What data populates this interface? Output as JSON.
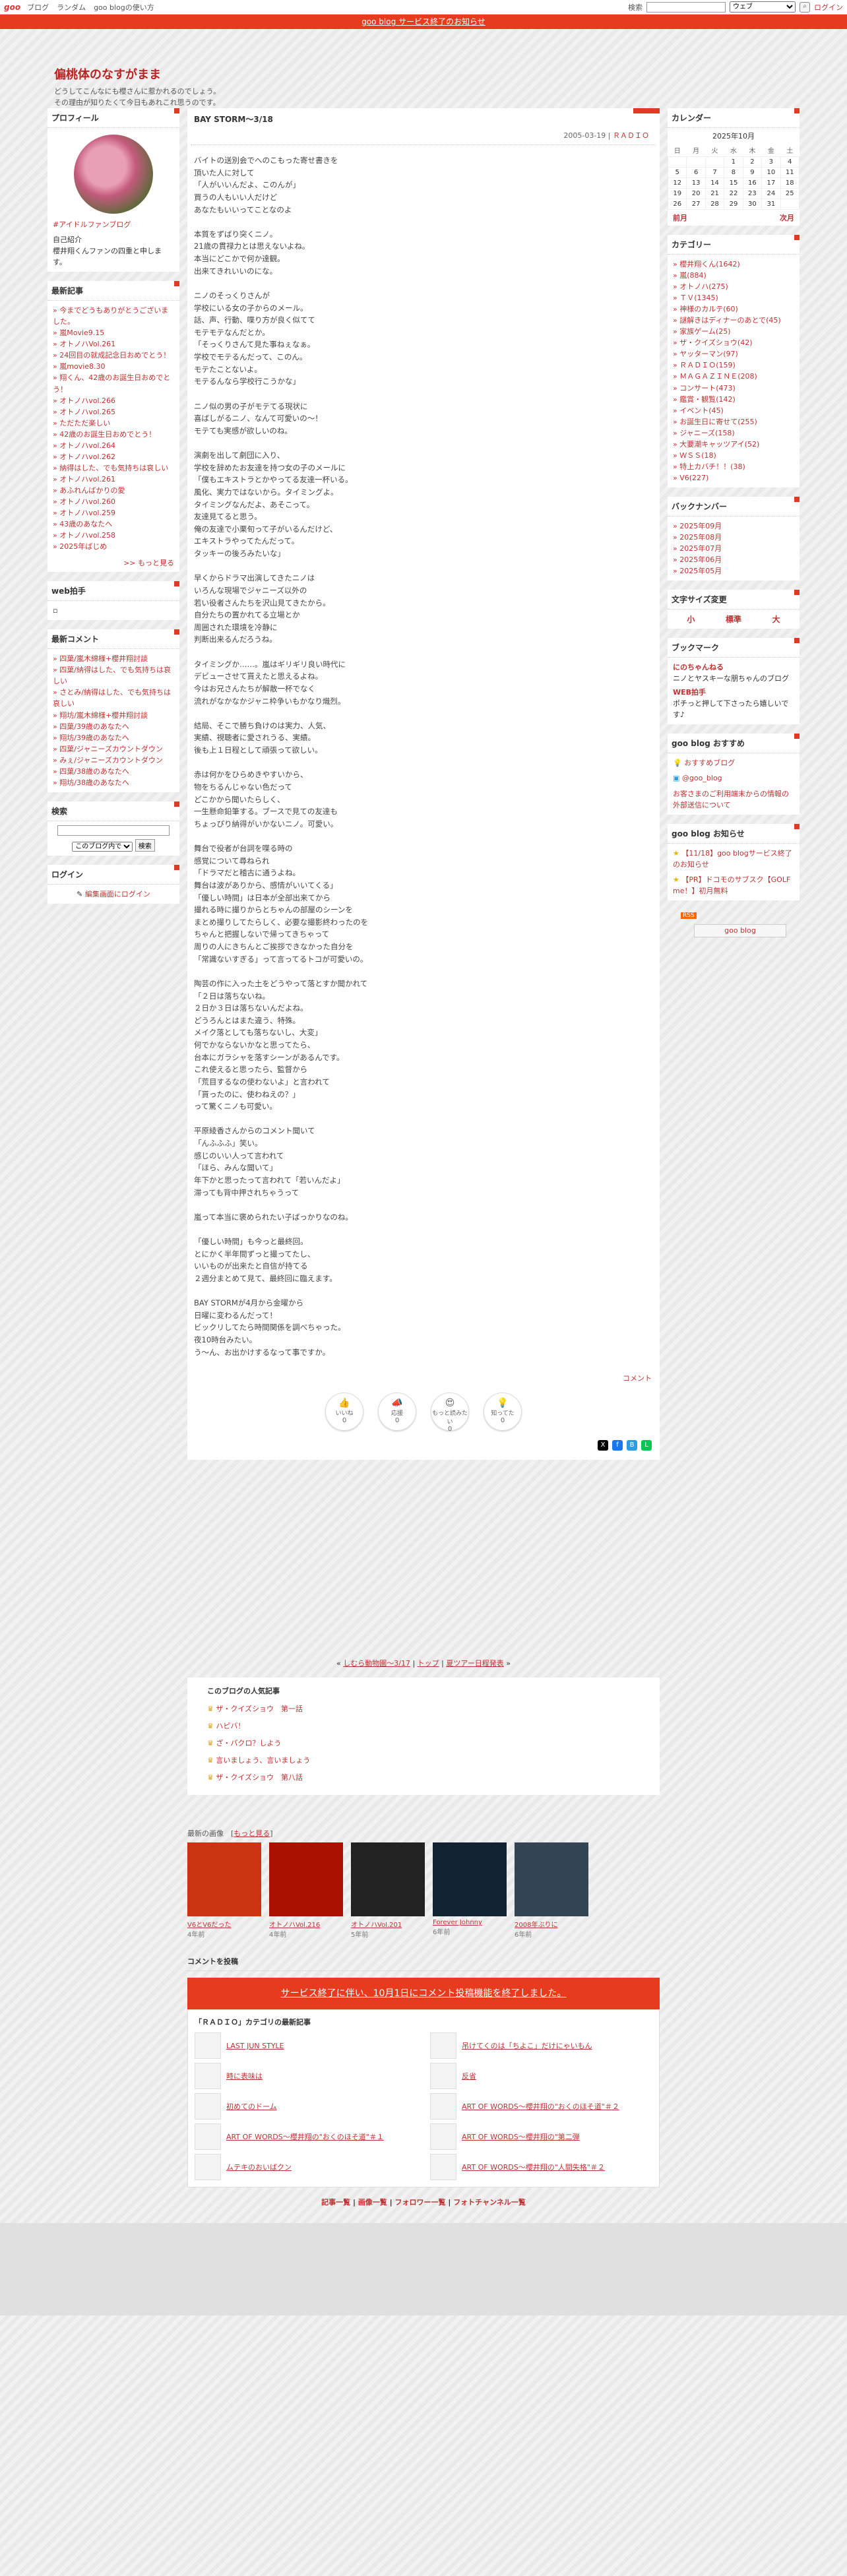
{
  "topbar": {
    "logo": "goo",
    "links": [
      "ブログ",
      "ランダム",
      "goo blogの使い方"
    ],
    "search_label": "検索",
    "search_scope": "ウェブ",
    "login": "ログイン"
  },
  "notice": "goo blog サービス終了のお知らせ",
  "blog": {
    "title": "偏桃体のなすがまま",
    "desc1": "どうしてこんなにも櫻さんに惹かれるのでしょう。",
    "desc2": "その理由が知りたくて今日もあれこれ思うのです。"
  },
  "profile": {
    "heading": "プロフィール",
    "link": "#アイドルファンブログ",
    "intro_title": "自己紹介",
    "intro": "櫻井翔くんファンの四重と申します。"
  },
  "recent": {
    "heading": "最新記事",
    "items": [
      "今までどうもありがとうございました。",
      "嵐Movie9.15",
      "オトノハVol.261",
      "24回目の就成記念日おめでとう！",
      "嵐movie8.30",
      "翔くん、42歳のお誕生日おめでとう！",
      "オトノハvol.266",
      "オトノハvol.265",
      "ただただ楽しい",
      "42歳のお誕生日おめでとう！",
      "オトノハvol.264",
      "オトノハvol.262",
      "納得はした、でも気持ちは哀しい",
      "オトノハvol.261",
      "あふれんばかりの愛",
      "オトノハvol.260",
      "オトノハvol.259",
      "43歳のあなたへ",
      "オトノハvol.258",
      "2025年ばじめ"
    ],
    "more": ">> もっと見る"
  },
  "webclap": {
    "heading": "web拍手"
  },
  "comments": {
    "heading": "最新コメント",
    "items": [
      "四葉/嵐木綿様+櫻井翔討談",
      "四葉/納得はした、でも気持ちは哀しい",
      "さとみ/納得はした、でも気持ちは哀しい",
      "翔坊/嵐木綿様+櫻井翔討談",
      "四葉/39歳のあなたへ",
      "翔坊/39歳のあなたへ",
      "四葉/ジャニーズカウントダウン",
      "みぇ/ジャニーズカウントダウン",
      "四葉/38歳のあなたへ",
      "翔坊/38歳のあなたへ"
    ]
  },
  "search": {
    "heading": "検索",
    "scope": "このブログ内で",
    "button": "検索"
  },
  "login": {
    "heading": "ログイン",
    "link": "編集画面にログイン"
  },
  "entry": {
    "title": "BAY STORM〜3/18",
    "date": "2005-03-19",
    "category": "ＲＡＤＩＯ",
    "comment_label": "コメント",
    "text": "バイトの送別会でへのこもった寄せ書きを\n頂いた人に対して\n「人がいいんだよ、このんが」\n買うの人もいい人だけど\nあなたもいいってことなのよ\n\n本質をずばり突くニノ。\n21歳の貫禄力とは思えないよね。\n本当にどこかで何か達観。\n出来てきれいいのにな。\n\nニノのそっくりさんが\n学校にいる女の子からのメール。\n話、声、行動、喋り方が良く似てて\nモテモテなんだとか。\n「そっくりさんて見た事ねぇなぁ。\n学校でモテるんだって、このん。\nモテたことないよ。\nモテるんなら学校行こうかな」\n\nニノ似の男の子がモテてる現状に\n喜ばしがるニノ、なんて可愛いの〜！\nモテても実感が欲しいのね。\n\n演劇を出して劇団に入り、\n学校を辞めたお友達を持つ女の子のメールに\n「僕もエキストラとかやってる友達一杯いる。\n風化、実力ではないから。タイミングよ。\nタイミングなんだよ、あそこって。\n友達見てると思う。\n俺の友達で小栗旬って子がいるんだけど、\nエキストラやってたんだって。\nタッキーの後ろみたいな」\n\n早くからドラマ出演してきたニノは\nいろんな現場でジャニーズ以外の\n若い役者さんたちを沢山見てきたから。\n自分たちの置かれてる立場とか\n周囲された環境を冷静に\n判断出来るんだろうね。\n\nタイミングか……。嵐はギリギリ良い時代に\nデビューさせて貰えたと思えるよね。\n今はお兄さんたちが解散一杯でなく\n流れがなかなかジャニ枠争いもかなり熾烈。\n\n結局、そこで勝ち負けのは実力、人気、\n実績、視聴者に愛されうる、実績。\n後も上１日程として頑張って欲しい。\n\n赤は何かをひらめきやすいから、\n物をちるんじゃない色だって\nどこかから聞いたらしく、\n一生懸命鉛筆する。ブースで見ての友達も\nちょっぴり納得がいかないニノ。可愛い。\n\n舞台で役者が台詞を喋る時の\n感覚について尋ねられ\n「ドラマだと稽古に通うよね。\n舞台は波がありから、感情がいいてくる」\n「優しい時間」は日本が全部出来てから\n撮れる時に撮りからとちゃんの部屋のシーンを\nまとめ撮りしてたらしく、必要な撮影終わったのを\nちゃんと把握しないで帰ってきちゃって\n周りの人にきちんとご挨拶できなかった自分を\n「常識ないすぎる」って言ってるトコが可愛いの。\n\n陶芸の作に入った土をどうやって落とすか聞かれて\n「２日は落ちないね。\n２日か３日は落ちないんだよね。\nどうろんとはまた違う、特殊。\nメイク落としても落ちないし、大変」\n何でかならないかなと思ってたら、\n台本にガラシャを落すシーンがあるんです。\nこれ使えると思ったら、監督から\n「荒目するなの使わないよ」と言われて\n「貰ったのに、使わねえの？」\nって驚くニノも可愛い。\n\n平原綾香さんからのコメント聞いて\n「んふふふ」笑い。\n感じのいい人って言われて\n「ほら、みんな聞いて」\n年下かと思ったって言われて「若いんだよ」\n滞っても背中押されちゃうって\n\n嵐って本当に褒められたい子ばっかりなのね。\n\n「優しい時間」も今っと最終回。\nとにかく半年間ずっと撮ってたし、\nいいものが出来たと自信が持てる\n２週分まとめて見て、最終回に臨えます。\n\nBAY STORMが4月から金曜から\n日曜に変わるんだって！\nビックリしてたら時間関係を調べちゃった。\n夜10時台みたい。\nう〜ん、お出かけするなって事ですか。"
  },
  "reactions": [
    {
      "label": "いいね",
      "count": "0"
    },
    {
      "label": "応援",
      "count": "0"
    },
    {
      "label": "もっと読みたい",
      "count": "0"
    },
    {
      "label": "知ってた",
      "count": "0"
    }
  ],
  "calendar": {
    "heading": "カレンダー",
    "month": "2025年10月",
    "weekdays": [
      "日",
      "月",
      "火",
      "水",
      "木",
      "金",
      "土"
    ],
    "weeks": [
      [
        "",
        "",
        "",
        "1",
        "2",
        "3",
        "4"
      ],
      [
        "5",
        "6",
        "7",
        "8",
        "9",
        "10",
        "11"
      ],
      [
        "12",
        "13",
        "14",
        "15",
        "16",
        "17",
        "18"
      ],
      [
        "19",
        "20",
        "21",
        "22",
        "23",
        "24",
        "25"
      ],
      [
        "26",
        "27",
        "28",
        "29",
        "30",
        "31",
        ""
      ]
    ],
    "prev": "前月",
    "next": "次月"
  },
  "categories": {
    "heading": "カテゴリー",
    "items": [
      "櫻井翔くん(1642)",
      "嵐(884)",
      "オトノハ(275)",
      "ＴＶ(1345)",
      "神様のカルテ(60)",
      "謎解きはディナーのあとで(45)",
      "家族ゲーム(25)",
      "ザ・クイズショウ(42)",
      "ヤッターマン(97)",
      "ＲＡＤＩＯ(159)",
      "ＭＡＧＡＺＩＮＥ(208)",
      "コンサート(473)",
      "鑑賞・観覧(142)",
      "イベント(45)",
      "お誕生日に寄せて(255)",
      "ジャニーズ(158)",
      "大要潮キャッツアイ(52)",
      "ＷＳＳ(18)",
      "特上カバチ！！(38)",
      "V6(227)"
    ]
  },
  "backnumber": {
    "heading": "バックナンバー",
    "items": [
      "2025年09月",
      "2025年08月",
      "2025年07月",
      "2025年06月",
      "2025年05月"
    ]
  },
  "fontsize": {
    "heading": "文字サイズ変更",
    "small": "小",
    "medium": "標準",
    "large": "大"
  },
  "bookmark": {
    "heading": "ブックマーク",
    "items": [
      {
        "title": "にのちゃんねる",
        "desc": "ニノとヤスキーな朋ちゃんのブログ"
      },
      {
        "title": "WEB拍手",
        "desc": "ポチっと押して下さったら嬉しいです♪"
      }
    ]
  },
  "recommend": {
    "heading": "goo blog おすすめ",
    "items": [
      "おすすめブログ",
      "@goo_blog",
      "お客さまのご利用端末からの情報の外部送信について"
    ]
  },
  "gooinfo": {
    "heading": "goo blog お知らせ",
    "items": [
      "【11/18】goo blogサービス終了のお知らせ",
      "【PR】ドコモのサブスク【GOLF me！】初月無料"
    ],
    "badge": "goo blog"
  },
  "pager": {
    "prev": "しむら動物園〜3/17",
    "top": "トップ",
    "next": "夏ツアー日程発表"
  },
  "popular": {
    "heading": "このブログの人気記事",
    "items": [
      "ザ・クイズショウ　第一話",
      "ハピバ！",
      "ざ・パクロ？しよう",
      "言いましょう、言いましょう",
      "ザ・クイズショウ　第八話"
    ]
  },
  "latest_images": {
    "label": "最新の画像",
    "more": "もっと見る",
    "items": [
      {
        "title": "V6とV6だった",
        "ago": "4年前"
      },
      {
        "title": "オトノハVol.216",
        "ago": "4年前"
      },
      {
        "title": "オトノハVol.201",
        "ago": "5年前"
      },
      {
        "title": "Forever Johnny",
        "ago": "6年前"
      },
      {
        "title": "2008年ぶりに",
        "ago": "6年前"
      }
    ]
  },
  "comment_post": {
    "heading": "コメントを投稿",
    "ended": "サービス終了に伴い、10月1日にコメント投稿機能を終了しました。"
  },
  "category_latest": {
    "heading": "「ＲＡＤＩＯ」カテゴリの最新記事",
    "items": [
      "LAST JUN STYLE",
      "吊けてくのは「ちよこ」だけにゃいもん",
      "時に表味は",
      "反省",
      "初めてのドーム",
      "ART OF WORDS〜櫻井翔の\"おくのほそ道\"＃２",
      "ART OF WORDS〜櫻井翔の\"おくのほそ道\"＃１",
      "ART OF WORDS〜櫻井翔の\"第二弾",
      "ムテキのおいばクン",
      "ART OF WORDS〜櫻井翔の\"人間失格\"＃２"
    ]
  },
  "footer": {
    "links": [
      "記事一覧",
      "画像一覧",
      "フォロワー一覧",
      "フォトチャンネル一覧"
    ]
  }
}
